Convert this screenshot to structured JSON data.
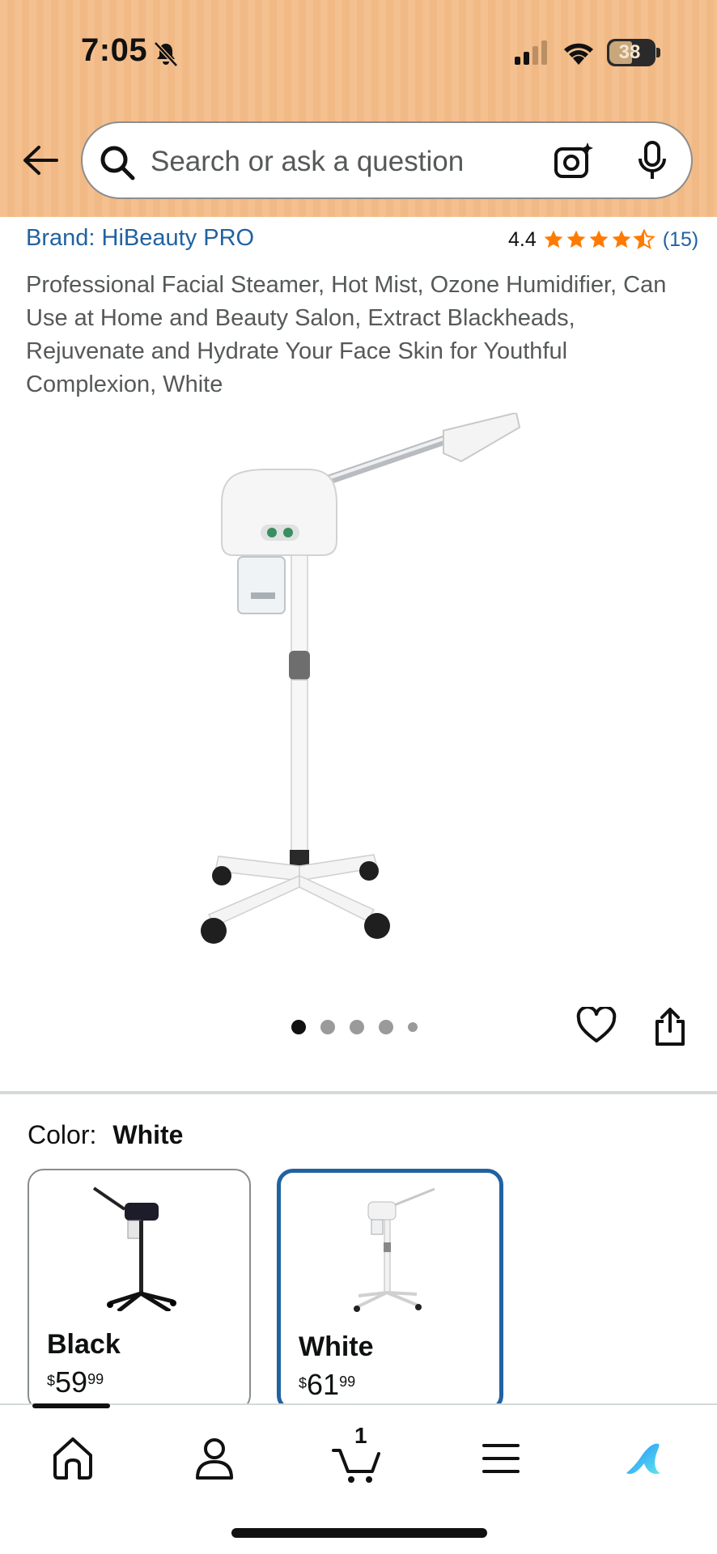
{
  "status_bar": {
    "time": "7:05",
    "battery": "38"
  },
  "search": {
    "placeholder": "Search or ask a question"
  },
  "product": {
    "brand": "Brand: HiBeauty PRO",
    "rating": "4.4",
    "rating_stars": 4.4,
    "rating_count": "(15)",
    "title": "Professional Facial Steamer, Hot Mist, Ozone Humidifier, Can Use at Home and Beauty Salon, Extract Blackheads, Rejuvenate and Hydrate Your Face Skin for Youthful Complexion, White",
    "image_count": 5,
    "active_image": 1
  },
  "color": {
    "label": "Color:",
    "selected": "White",
    "options": [
      {
        "name": "Black",
        "price_symbol": "$",
        "price_whole": "59",
        "price_fraction": "99"
      },
      {
        "name": "White",
        "price_symbol": "$",
        "price_whole": "61",
        "price_fraction": "99"
      }
    ]
  },
  "nav": {
    "cart_count": "1"
  },
  "colors": {
    "header": "#f4c08f",
    "link": "#2162a1",
    "star": "#ff7a00",
    "selected_border": "#2162a1"
  },
  "icons": [
    "bell-slash-icon",
    "signal-icon",
    "wifi-icon",
    "battery-icon",
    "back-arrow-icon",
    "search-icon",
    "camera-icon",
    "mic-icon",
    "star-icon",
    "heart-icon",
    "share-icon",
    "home-icon",
    "account-icon",
    "cart-icon",
    "menu-icon",
    "rufus-icon"
  ]
}
